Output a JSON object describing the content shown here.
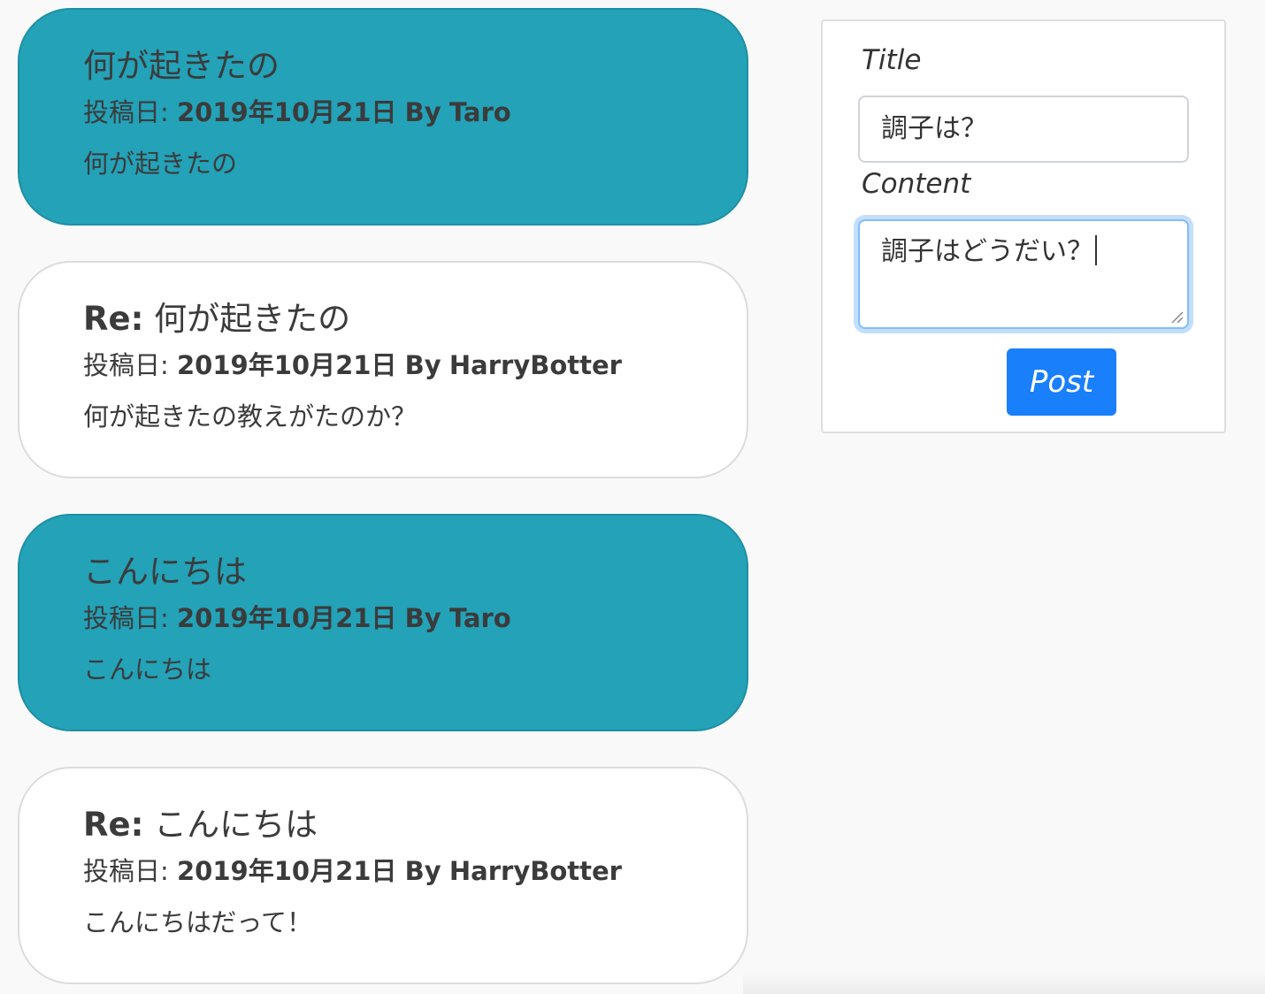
{
  "posts": [
    {
      "style": "teal",
      "re_prefix": "",
      "title": "何が起きたの",
      "date_label": "投稿日:",
      "date": "2019年10月21日",
      "by": "By",
      "author": "Taro",
      "body": "何が起きたの"
    },
    {
      "style": "white",
      "re_prefix": "Re:",
      "title": "何が起きたの",
      "date_label": "投稿日:",
      "date": "2019年10月21日",
      "by": "By",
      "author": "HarryBotter",
      "body": "何が起きたの教えがたのか？"
    },
    {
      "style": "teal",
      "re_prefix": "",
      "title": "こんにちは",
      "date_label": "投稿日:",
      "date": "2019年10月21日",
      "by": "By",
      "author": "Taro",
      "body": "こんにちは"
    },
    {
      "style": "white",
      "re_prefix": "Re:",
      "title": "こんにちは",
      "date_label": "投稿日:",
      "date": "2019年10月21日",
      "by": "By",
      "author": "HarryBotter",
      "body": "こんにちはだって！"
    }
  ],
  "form": {
    "title_label": "Title",
    "title_value": "調子は？",
    "content_label": "Content",
    "content_value": "調子はどうだい？",
    "post_button_label": "Post"
  },
  "colors": {
    "teal_card": "#23a2b8",
    "white_card": "#ffffff",
    "button_primary": "#1a7ffb",
    "focus_border": "#80bdff",
    "page_background": "#f9f9f9"
  }
}
